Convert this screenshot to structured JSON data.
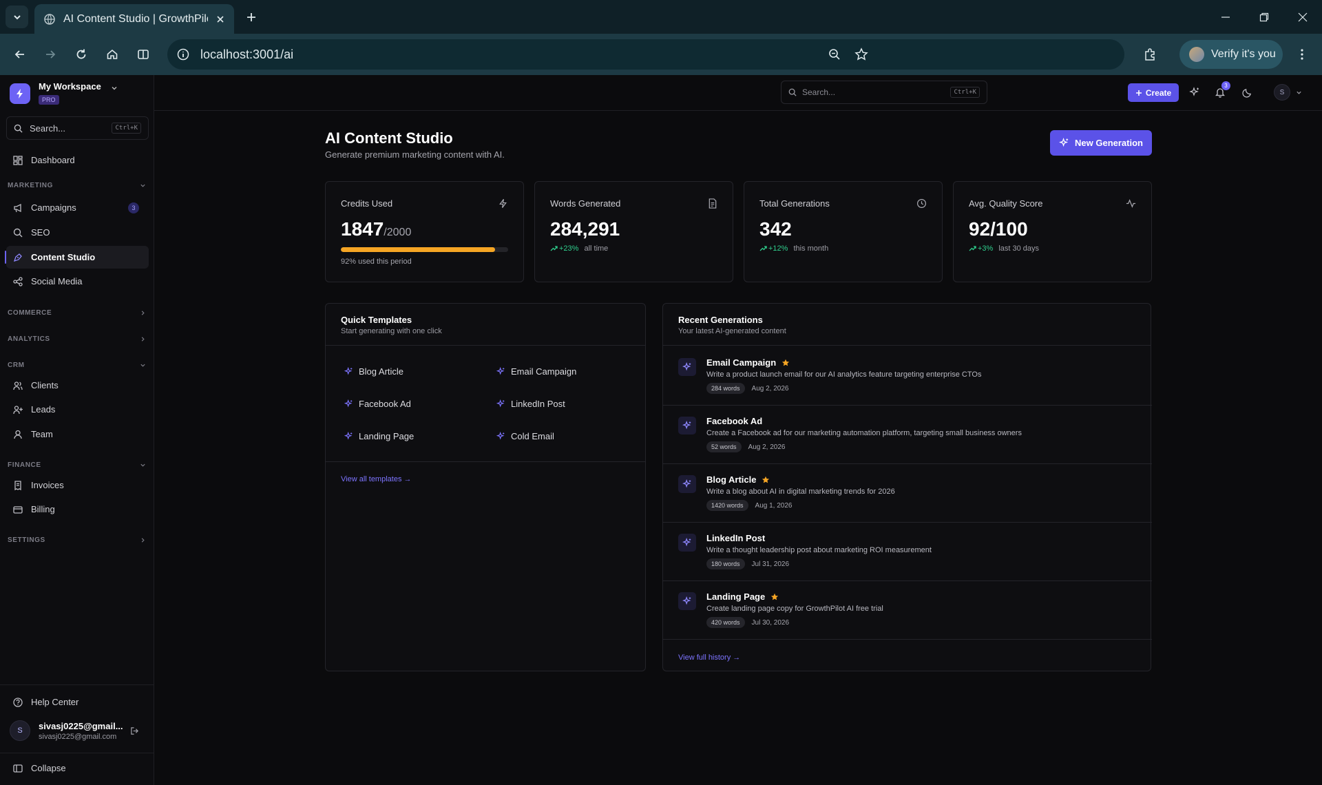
{
  "browser": {
    "tab_title": "AI Content Studio | GrowthPilot",
    "url": "localhost:3001/ai",
    "verify_label": "Verify it's you"
  },
  "sidebar": {
    "workspace_name": "My Workspace",
    "plan_badge": "PRO",
    "search_placeholder": "Search...",
    "search_shortcut": "Ctrl+K",
    "dashboard": "Dashboard",
    "sections": {
      "marketing": "MARKETING",
      "commerce": "COMMERCE",
      "analytics": "ANALYTICS",
      "crm": "CRM",
      "finance": "FINANCE",
      "settings": "SETTINGS"
    },
    "marketing_items": [
      {
        "label": "Campaigns",
        "badge": "3"
      },
      {
        "label": "SEO"
      },
      {
        "label": "Content Studio"
      },
      {
        "label": "Social Media"
      }
    ],
    "crm_items": [
      {
        "label": "Clients"
      },
      {
        "label": "Leads"
      },
      {
        "label": "Team"
      }
    ],
    "finance_items": [
      {
        "label": "Invoices"
      },
      {
        "label": "Billing"
      }
    ],
    "help": "Help Center",
    "user_name": "sivasj0225@gmail...",
    "user_email": "sivasj0225@gmail.com",
    "user_initial": "S",
    "collapse": "Collapse"
  },
  "topbar": {
    "search_placeholder": "Search...",
    "search_shortcut": "Ctrl+K",
    "create_label": "Create",
    "notification_count": "3",
    "avatar_initial": "S"
  },
  "main": {
    "title": "AI Content Studio",
    "subtitle": "Generate premium marketing content with AI.",
    "new_generation": "New Generation",
    "stats": [
      {
        "label": "Credits Used",
        "value": "1847",
        "suffix": "/2000",
        "note": "92% used this period",
        "progress": 0.92,
        "icon": "lightning-icon"
      },
      {
        "label": "Words Generated",
        "value": "284,291",
        "trend": "+23%",
        "note": "all time",
        "icon": "document-icon"
      },
      {
        "label": "Total Generations",
        "value": "342",
        "trend": "+12%",
        "note": "this month",
        "icon": "clock-icon"
      },
      {
        "label": "Avg. Quality Score",
        "value": "92/100",
        "trend": "+3%",
        "note": "last 30 days",
        "icon": "activity-icon"
      }
    ],
    "templates": {
      "title": "Quick Templates",
      "subtitle": "Start generating with one click",
      "items": [
        "Blog Article",
        "Email Campaign",
        "Facebook Ad",
        "LinkedIn Post",
        "Landing Page",
        "Cold Email"
      ],
      "view_all": "View all templates →"
    },
    "recent": {
      "title": "Recent Generations",
      "subtitle": "Your latest AI-generated content",
      "items": [
        {
          "title": "Email Campaign",
          "starred": true,
          "desc": "Write a product launch email for our AI analytics feature targeting enterprise CTOs",
          "words": "284 words",
          "date": "Aug 2, 2026"
        },
        {
          "title": "Facebook Ad",
          "starred": false,
          "desc": "Create a Facebook ad for our marketing automation platform, targeting small business owners",
          "words": "52 words",
          "date": "Aug 2, 2026"
        },
        {
          "title": "Blog Article",
          "starred": true,
          "desc": "Write a blog about AI in digital marketing trends for 2026",
          "words": "1420 words",
          "date": "Aug 1, 2026"
        },
        {
          "title": "LinkedIn Post",
          "starred": false,
          "desc": "Write a thought leadership post about marketing ROI measurement",
          "words": "180 words",
          "date": "Jul 31, 2026"
        },
        {
          "title": "Landing Page",
          "starred": true,
          "desc": "Create landing page copy for GrowthPilot AI free trial",
          "words": "420 words",
          "date": "Jul 30, 2026"
        }
      ],
      "view_all": "View full history →"
    },
    "colors": {
      "accent": "#5b52e8",
      "progress": "#f5a524",
      "trend_up": "#2fcf8d",
      "star": "#f5a524"
    }
  }
}
